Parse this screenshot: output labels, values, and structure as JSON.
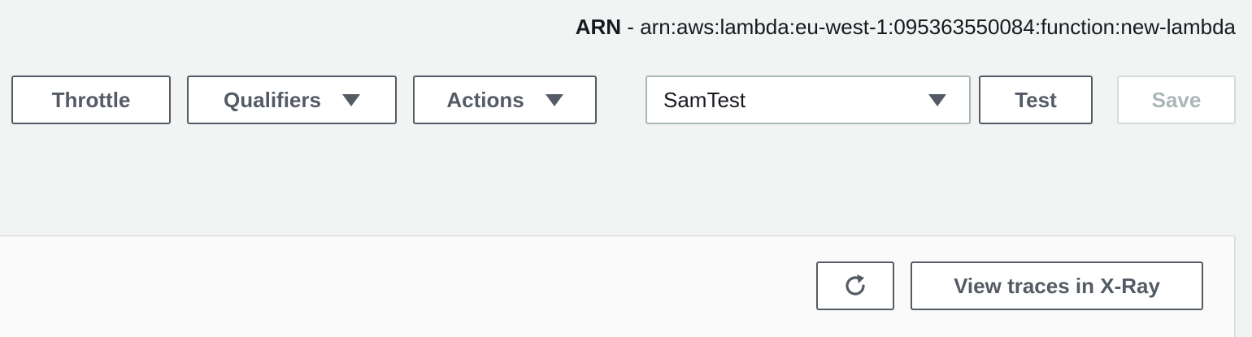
{
  "header": {
    "arn_label": "ARN",
    "arn_separator": " - ",
    "arn_value": "arn:aws:lambda:eu-west-1:095363550084:function:new-lambda"
  },
  "toolbar": {
    "throttle_label": "Throttle",
    "qualifiers_label": "Qualifiers",
    "actions_label": "Actions",
    "test_event_selected": "SamTest",
    "test_label": "Test",
    "save_label": "Save"
  },
  "monitoring": {
    "refresh_icon": "refresh-icon",
    "view_traces_label": "View traces in X-Ray"
  },
  "colors": {
    "background": "#f2f3f3",
    "button_border": "#545b64",
    "disabled_text": "#aab7b8"
  }
}
